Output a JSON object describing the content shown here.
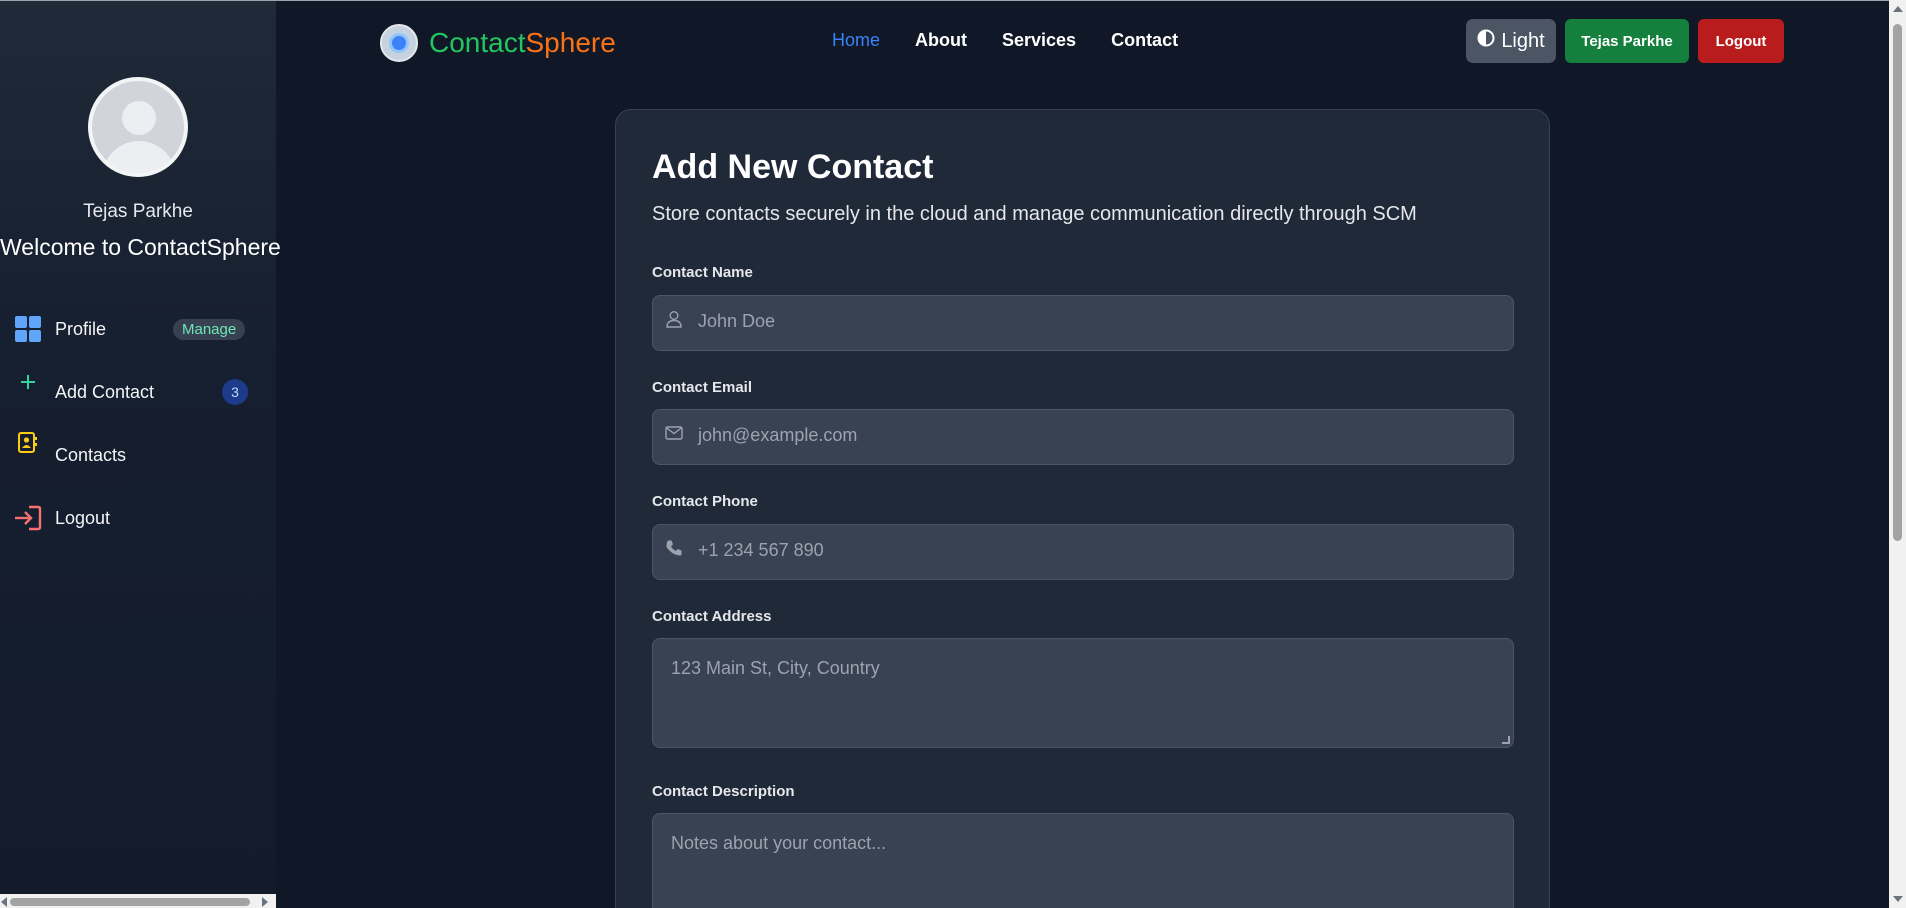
{
  "sidebar": {
    "user_name": "Tejas Parkhe",
    "welcome": "Welcome to ContactSphere",
    "items": [
      {
        "label": "Profile",
        "icon": "grid-icon",
        "badge": "Manage"
      },
      {
        "label": "Add Contact",
        "icon": "plus-icon",
        "badge": "3"
      },
      {
        "label": "Contacts",
        "icon": "address-book-icon"
      },
      {
        "label": "Logout",
        "icon": "logout-icon"
      }
    ]
  },
  "navbar": {
    "brand_part1": "Contact",
    "brand_part2": "Sphere",
    "links": [
      "Home",
      "About",
      "Services",
      "Contact"
    ],
    "active_link": "Home",
    "theme_button": "Light",
    "user_button": "Tejas Parkhe",
    "logout_button": "Logout"
  },
  "form": {
    "title": "Add New Contact",
    "subtitle": "Store contacts securely in the cloud and manage communication directly through SCM",
    "fields": [
      {
        "label": "Contact Name",
        "placeholder": "John Doe",
        "icon": "user-icon"
      },
      {
        "label": "Contact Email",
        "placeholder": "john@example.com",
        "icon": "envelope-icon"
      },
      {
        "label": "Contact Phone",
        "placeholder": "+1 234 567 890",
        "icon": "phone-icon"
      },
      {
        "label": "Contact Address",
        "placeholder": "123 Main St, City, Country"
      },
      {
        "label": "Contact Description",
        "placeholder": "Notes about your contact..."
      }
    ]
  },
  "colors": {
    "background": "#101828",
    "card": "#1f2937",
    "brand_green": "#22c55e",
    "brand_orange": "#f97316",
    "accent_blue": "#3b82f6",
    "user_button": "#15803d",
    "logout_button": "#b91c1c"
  }
}
